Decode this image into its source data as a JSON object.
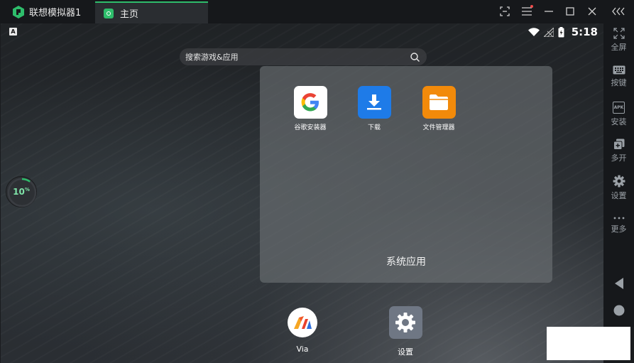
{
  "titlebar": {
    "app_name": "联想模拟器1",
    "tab_label": "主页",
    "icons": [
      "screenshot-icon",
      "menu-icon",
      "minimize-icon",
      "maximize-icon",
      "close-icon",
      "collapse-icon"
    ]
  },
  "status_bar": {
    "indicator": "A",
    "time": "5:18"
  },
  "search": {
    "placeholder": "搜索游戏&应用"
  },
  "gauge": {
    "value": "10",
    "unit": "%",
    "percent": 10
  },
  "folder": {
    "title": "系统应用",
    "apps": [
      {
        "label": "谷歌安装器",
        "icon": "google-icon"
      },
      {
        "label": "下载",
        "icon": "download-icon"
      },
      {
        "label": "文件管理器",
        "icon": "folder-icon"
      }
    ]
  },
  "dock": [
    {
      "label": "Via",
      "icon": "via-browser-icon"
    },
    {
      "label": "设置",
      "icon": "settings-gear-icon"
    }
  ],
  "sidebar": {
    "items": [
      {
        "label": "全屏",
        "icon": "fullscreen-icon"
      },
      {
        "label": "按键",
        "icon": "keyboard-icon"
      },
      {
        "label": "安装",
        "icon": "apk-icon",
        "icon_text": "APK"
      },
      {
        "label": "多开",
        "icon": "multi-instance-icon"
      },
      {
        "label": "设置",
        "icon": "gear-icon"
      },
      {
        "label": "更多",
        "icon": "more-icon"
      }
    ],
    "nav": [
      "back-icon",
      "home-icon"
    ]
  },
  "colors": {
    "accent": "#2ebd6b",
    "download_blue": "#1e7be8",
    "folder_orange": "#f28a0a",
    "settings_gray": "#6f7784"
  }
}
